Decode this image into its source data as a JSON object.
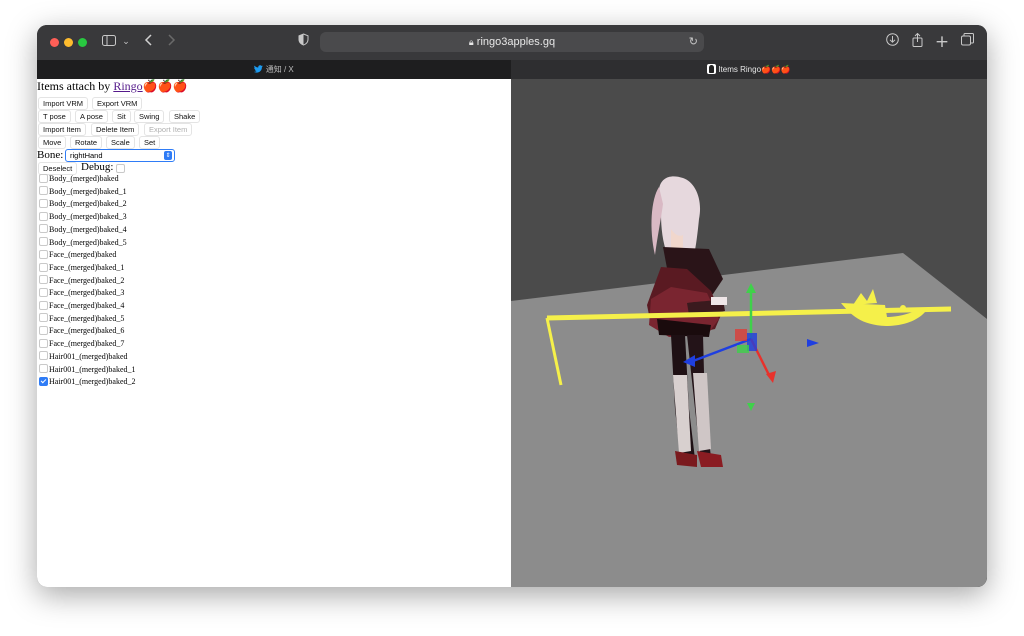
{
  "browser": {
    "url": "ringo3apples.gq",
    "tabs": [
      {
        "label": "通知 / X",
        "icon": "twitter-bird-icon",
        "active": false
      },
      {
        "label": "Items Ringo🍎🍎🍎",
        "icon": "character-favicon-icon",
        "active": true
      }
    ]
  },
  "app": {
    "title_prefix": "Items attach by ",
    "title_link": "Ringo",
    "title_suffix": "🍎🍎🍎",
    "buttons": {
      "import_vrm": "Import VRM",
      "export_vrm": "Export VRM",
      "t_pose": "T pose",
      "a_pose": "A pose",
      "sit": "Sit",
      "swing": "Swing",
      "shake": "Shake",
      "import_item": "Import Item",
      "delete_item": "Delete Item",
      "export_item": "Export Item",
      "move": "Move",
      "rotate": "Rotate",
      "scale": "Scale",
      "set": "Set",
      "deselect": "Deselect"
    },
    "bone_label": "Bone:",
    "bone_value": "rightHand",
    "debug_label": "Debug:",
    "debug_checked": false,
    "meshes": [
      {
        "label": "Body_(merged)baked",
        "checked": false
      },
      {
        "label": "Body_(merged)baked_1",
        "checked": false
      },
      {
        "label": "Body_(merged)baked_2",
        "checked": false
      },
      {
        "label": "Body_(merged)baked_3",
        "checked": false
      },
      {
        "label": "Body_(merged)baked_4",
        "checked": false
      },
      {
        "label": "Body_(merged)baked_5",
        "checked": false
      },
      {
        "label": "Face_(merged)baked",
        "checked": false
      },
      {
        "label": "Face_(merged)baked_1",
        "checked": false
      },
      {
        "label": "Face_(merged)baked_2",
        "checked": false
      },
      {
        "label": "Face_(merged)baked_3",
        "checked": false
      },
      {
        "label": "Face_(merged)baked_4",
        "checked": false
      },
      {
        "label": "Face_(merged)baked_5",
        "checked": false
      },
      {
        "label": "Face_(merged)baked_6",
        "checked": false
      },
      {
        "label": "Face_(merged)baked_7",
        "checked": false
      },
      {
        "label": "Hair001_(merged)baked",
        "checked": false
      },
      {
        "label": "Hair001_(merged)baked_1",
        "checked": false
      },
      {
        "label": "Hair001_(merged)baked_2",
        "checked": true
      }
    ]
  },
  "colors": {
    "accent": "#2f7cf6",
    "link": "#551a8b",
    "item_yellow": "#f5f04a",
    "gizmo_red": "#e8322c",
    "gizmo_green": "#3fd14a",
    "gizmo_blue": "#1f3fe0"
  }
}
